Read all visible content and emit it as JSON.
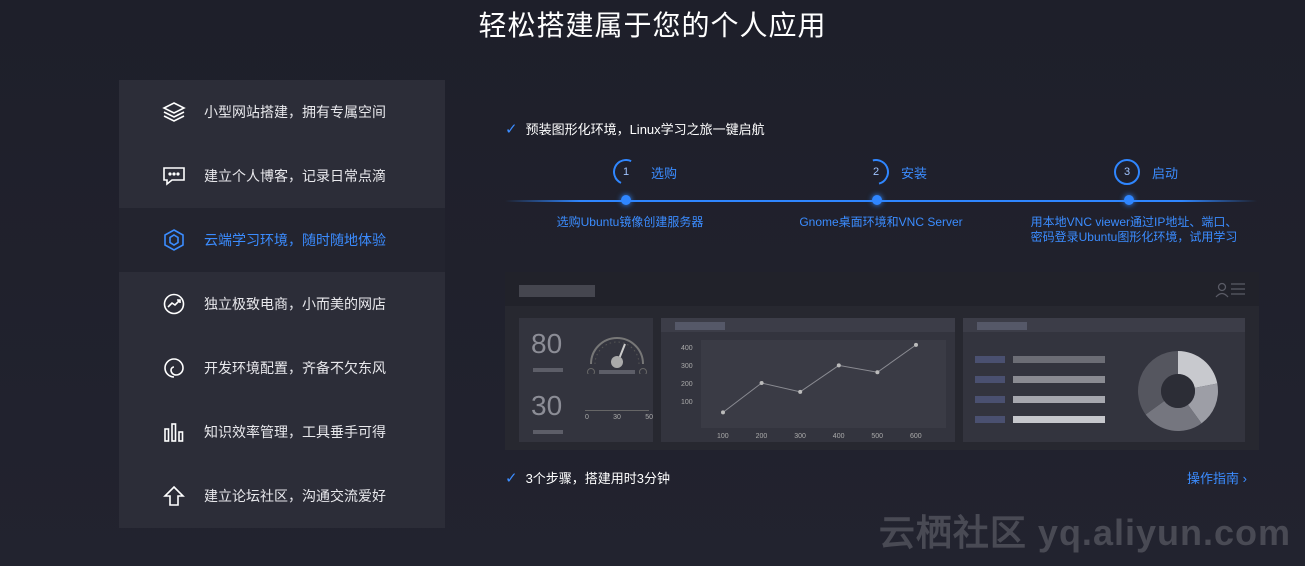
{
  "page": {
    "title": "轻松搭建属于您的个人应用"
  },
  "sidebar": {
    "items": [
      {
        "label": "小型网站搭建，拥有专属空间",
        "icon": "layers-icon"
      },
      {
        "label": "建立个人博客，记录日常点滴",
        "icon": "chat-bubble-icon"
      },
      {
        "label": "云端学习环境，随时随地体验",
        "icon": "hexagon-icon",
        "active": true
      },
      {
        "label": "独立极致电商，小而美的网店",
        "icon": "trend-circle-icon"
      },
      {
        "label": "开发环境配置，齐备不欠东风",
        "icon": "spiral-icon"
      },
      {
        "label": "知识效率管理，工具垂手可得",
        "icon": "bar-chart-icon"
      },
      {
        "label": "建立论坛社区，沟通交流爱好",
        "icon": "arrow-up-icon"
      }
    ]
  },
  "main": {
    "intro": "预装图形化环境，Linux学习之旅一键启航",
    "steps": [
      {
        "num": "1",
        "label": "选购",
        "desc": "选购Ubuntu镜像创建服务器"
      },
      {
        "num": "2",
        "label": "安装",
        "desc": "Gnome桌面环境和VNC Server"
      },
      {
        "num": "3",
        "label": "启动",
        "desc_line1": "用本地VNC viewer通过IP地址、端口、",
        "desc_line2": "密码登录Ubuntu图形化环境，试用学习"
      }
    ],
    "summary": "3个步骤，搭建用时3分钟",
    "guide_link": "操作指南 ›"
  },
  "mock_dashboard": {
    "metric_a": "80",
    "metric_b": "30",
    "gauge_ticks": [
      "0",
      "30",
      "50"
    ],
    "line_chart": {
      "y_ticks": [
        "400",
        "300",
        "200",
        "100"
      ],
      "x_ticks": [
        "100",
        "200",
        "300",
        "400",
        "500",
        "600"
      ],
      "values": [
        80,
        230,
        185,
        320,
        285,
        425
      ]
    },
    "donut": {
      "slices": [
        0.22,
        0.18,
        0.25,
        0.35
      ]
    }
  },
  "colors": {
    "accent": "#2f86ff",
    "sidebar_bg": "#2c2d38",
    "page_bg": "#1f202b"
  },
  "watermark": "云栖社区 yq.aliyun.com"
}
